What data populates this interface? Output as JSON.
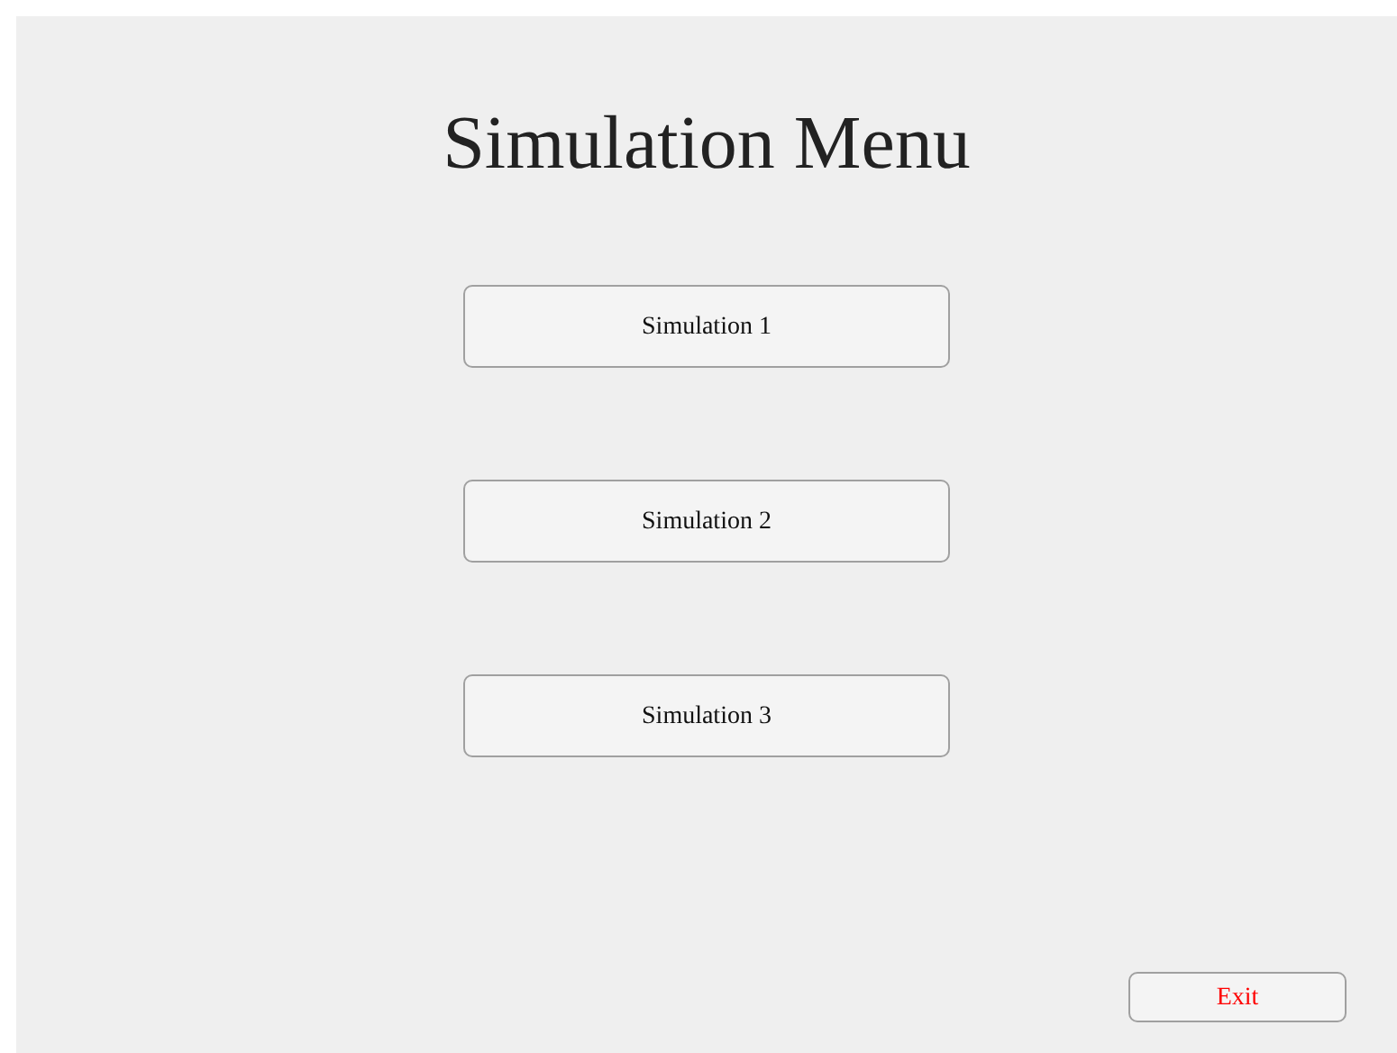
{
  "title": "Simulation Menu",
  "buttons": [
    {
      "label": "Simulation 1"
    },
    {
      "label": "Simulation 2"
    },
    {
      "label": "Simulation 3"
    }
  ],
  "exit_button": {
    "label": "Exit"
  }
}
